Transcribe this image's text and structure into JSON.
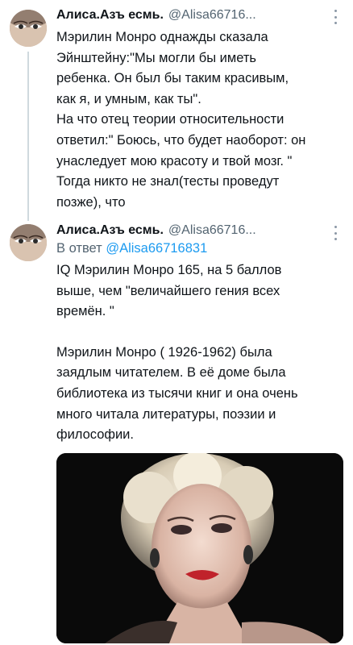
{
  "tweet1": {
    "author_name": "Алиса.Азъ есмь.",
    "handle": "@Alisa66716...",
    "text": "Мэрилин Монро однажды сказала\nЭйнштейну:\"Мы могли бы иметь\nребенка. Он был бы таким красивым,\nкак я, и умным, как ты\".\nНа что отец теории относительности\nответил:\" Боюсь, что будет наоборот: он\nунаследует мою красоту и твой мозг. \"\nТогда никто не знал(тесты проведут\nпозже), что"
  },
  "tweet2": {
    "author_name": "Алиса.Азъ есмь.",
    "handle": "@Alisa66716...",
    "reply_prefix": "В ответ",
    "reply_mention": "@Alisa66716831",
    "text_1": "IQ Мэрилин Монро 165, на 5 баллов\nвыше, чем \"величайшего гения всех\nвремён. \"",
    "text_2": "Мэрилин Монро ( 1926-1962) была\nзаядлым читателем. В её доме была\nбиблиотека из тысячи книг и она очень\nмного читала литературы, поэзии и\nфилософии."
  },
  "colors": {
    "text_primary": "#0f1419",
    "text_secondary": "#536471",
    "mention": "#1d9bf0",
    "thread_line": "#cfd9de"
  },
  "icons": [
    "more-icon",
    "avatar-image",
    "media-photo"
  ]
}
